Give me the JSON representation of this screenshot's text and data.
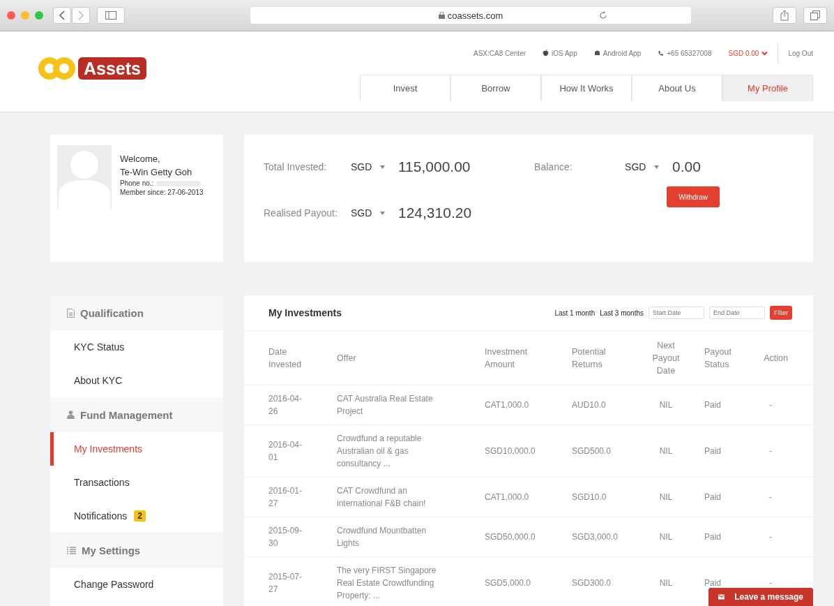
{
  "browser": {
    "url": "coassets.com"
  },
  "logo": {
    "text": "Assets"
  },
  "header": {
    "top_links": [
      "ASX:CA8 Center",
      "iOS App",
      "Android App",
      "+65 65327008"
    ],
    "balance_menu": "SGD 0.00",
    "logout": "Log Out",
    "tabs": [
      {
        "label": "Invest",
        "selected": false
      },
      {
        "label": "Borrow",
        "selected": false
      },
      {
        "label": "How It Works",
        "selected": false
      },
      {
        "label": "About Us",
        "selected": false
      },
      {
        "label": "My Profile",
        "selected": true
      }
    ]
  },
  "profile": {
    "welcome": "Welcome,",
    "name": "Te-Win Getty Goh",
    "phone_label": "Phone no.:",
    "member_since": "Member since: 27-06-2013"
  },
  "stats": {
    "total_invested": {
      "label": "Total Invested:",
      "currency": "SGD",
      "amount": "115,000.00"
    },
    "realised_payout": {
      "label": "Realised Payout:",
      "currency": "SGD",
      "amount": "124,310.20"
    },
    "balance": {
      "label": "Balance:",
      "currency": "SGD",
      "amount": "0.00"
    },
    "withdraw": "Withdraw"
  },
  "sidebar": [
    {
      "title": "Qualification",
      "items": [
        {
          "label": "KYC Status",
          "selected": false
        },
        {
          "label": "About KYC",
          "selected": false
        }
      ]
    },
    {
      "title": "Fund Management",
      "items": [
        {
          "label": "My Investments",
          "selected": true
        },
        {
          "label": "Transactions",
          "selected": false
        },
        {
          "label": "Notifications",
          "selected": false,
          "badge": "2"
        }
      ]
    },
    {
      "title": "My Settings",
      "items": [
        {
          "label": "Change Password",
          "selected": false
        }
      ]
    }
  ],
  "investments": {
    "title": "My Investments",
    "filters": [
      "Last 1 month",
      "Last 3 months"
    ],
    "start_placeholder": "Start Date",
    "end_placeholder": "End Date",
    "filter_button": "Filter",
    "columns": [
      "Date Invested",
      "Offer",
      "Investment Amount",
      "Potential Returns",
      "Next Payout Date",
      "Payout Status",
      "Action"
    ],
    "rows": [
      [
        "2016-04-26",
        "CAT Australia Real Estate Project",
        "CAT1,000.0",
        "AUD10.0",
        "NIL",
        "Paid",
        "-"
      ],
      [
        "2016-04-01",
        "Crowdfund a reputable Australian oil & gas consultancy ...",
        "SGD10,000.0",
        "SGD500.0",
        "NIL",
        "Paid",
        "-"
      ],
      [
        "2016-01-27",
        "CAT Crowdfund an international F&B chain!",
        "CAT1,000.0",
        "SGD10.0",
        "NIL",
        "Paid",
        "-"
      ],
      [
        "2015-09-30",
        "Crowdfund Mountbatten Lights",
        "SGD50,000.0",
        "SGD3,000.0",
        "NIL",
        "Paid",
        "-"
      ],
      [
        "2015-07-27",
        "The very FIRST Singapore Real Estate Crowdfunding Property: ...",
        "SGD5,000.0",
        "SGD300.0",
        "NIL",
        "Paid",
        "-"
      ]
    ]
  },
  "chat": {
    "label": "Leave a message"
  }
}
